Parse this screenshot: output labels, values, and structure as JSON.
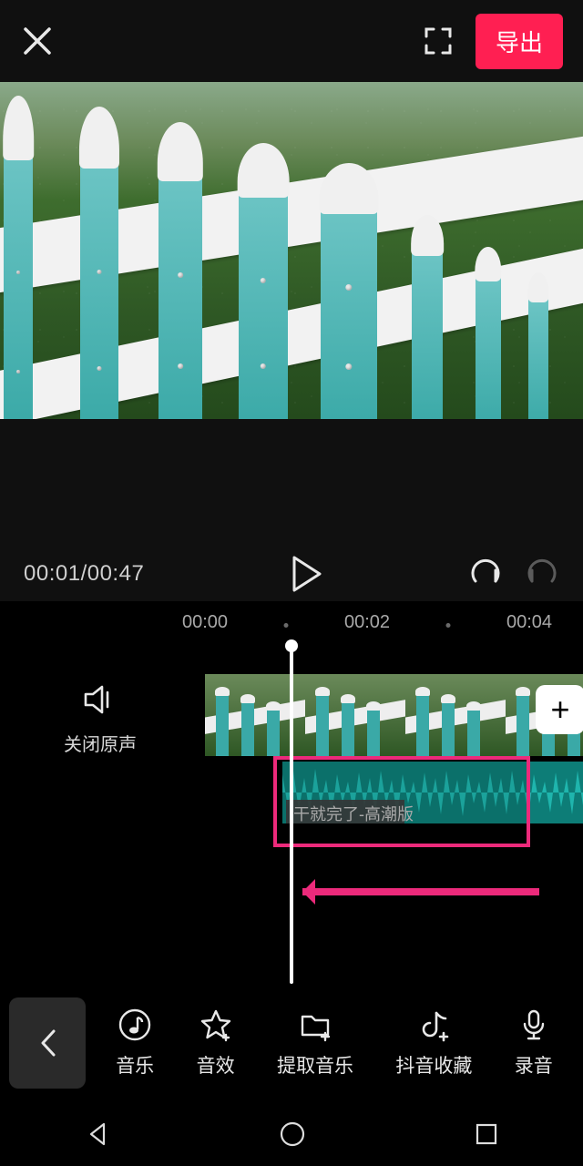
{
  "header": {
    "export_label": "导出"
  },
  "playback": {
    "current": "00:01",
    "total": "00:47"
  },
  "ruler": {
    "t0": "00:00",
    "t1": "00:02",
    "t2": "00:04"
  },
  "mute": {
    "label": "关闭原声"
  },
  "audio": {
    "title": "干就完了-高潮版"
  },
  "toolbar": {
    "music": "音乐",
    "sfx": "音效",
    "extract": "提取音乐",
    "douyin": "抖音收藏",
    "record": "录音"
  },
  "icons": {
    "plus": "+"
  },
  "colors": {
    "accent": "#ff1f52",
    "annotation": "#ec2a7b",
    "wave": "#1fb5ad"
  }
}
